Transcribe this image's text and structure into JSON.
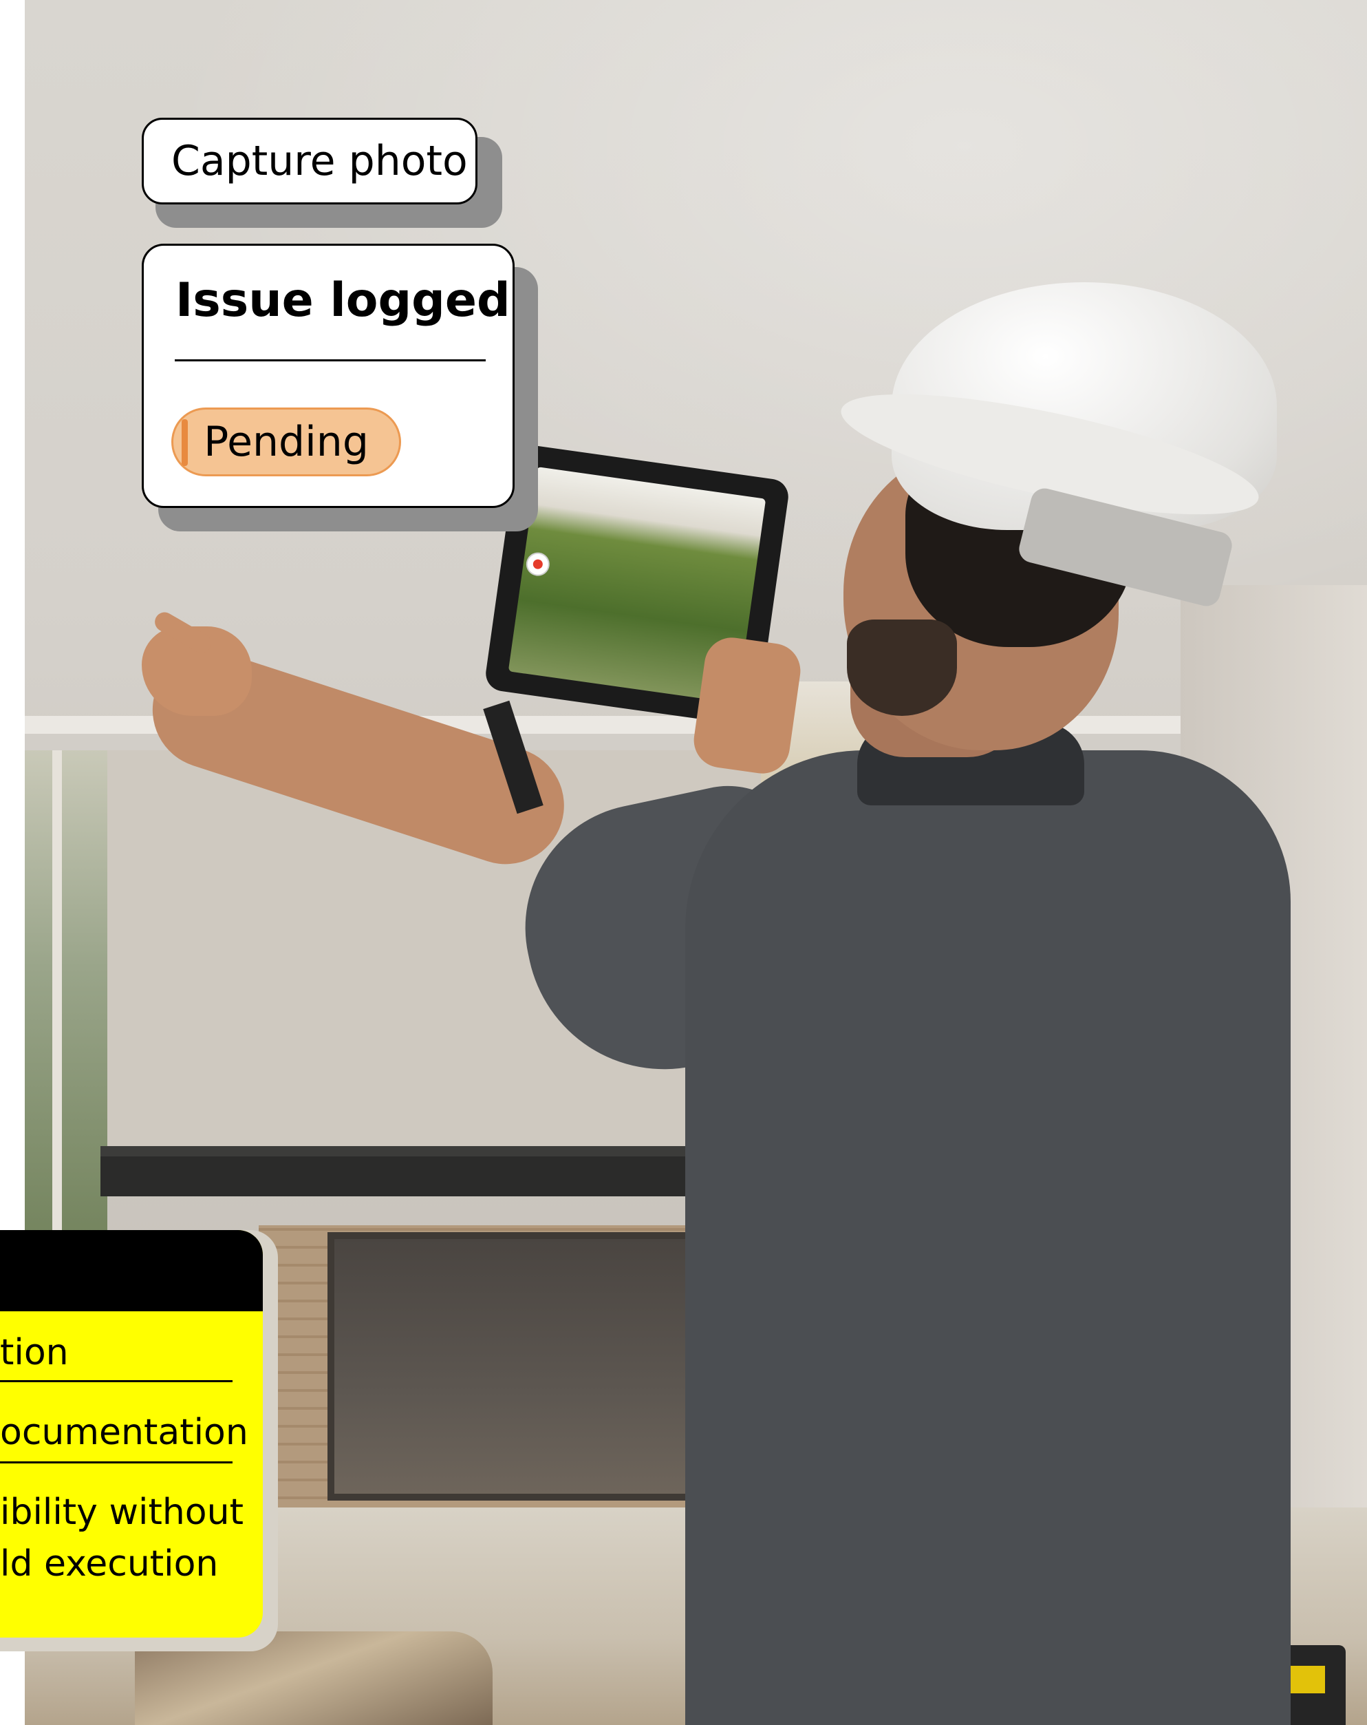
{
  "capture_chip": {
    "label": "Capture photo"
  },
  "issue_card": {
    "title": "Issue logged",
    "status": "Pending"
  },
  "yellow_card": {
    "items": [
      "tion",
      "ocumentation"
    ],
    "last_item_lines": [
      "ibility without",
      "ld execution"
    ]
  },
  "colors": {
    "pending_fill": "#f5c493",
    "pending_border": "#ec9a52",
    "card_yellow": "#ffff00",
    "card_header": "#000000"
  },
  "icons": [
    "record-icon"
  ]
}
